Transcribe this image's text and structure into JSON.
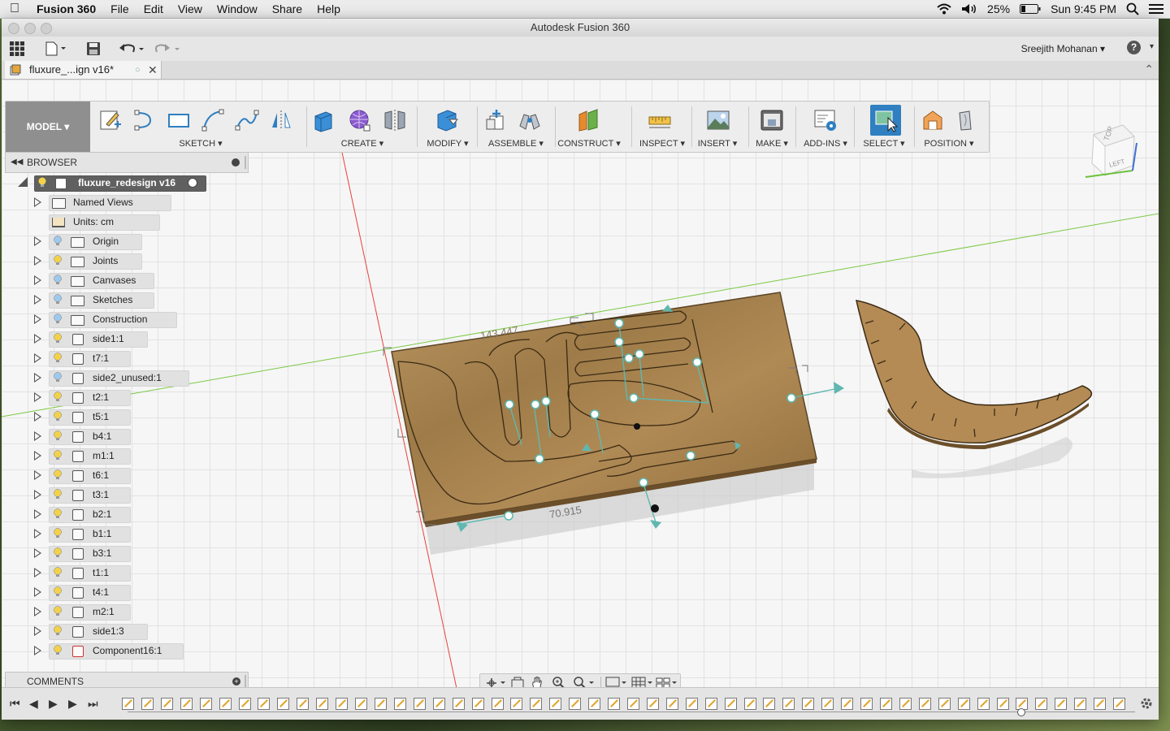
{
  "menubar": {
    "app": "Fusion 360",
    "items": [
      "File",
      "Edit",
      "View",
      "Window",
      "Share",
      "Help"
    ],
    "battery": "25%",
    "clock": "Sun 9:45 PM"
  },
  "window": {
    "title": "Autodesk Fusion 360",
    "user": "Sreejith Mohanan",
    "help": "?",
    "doc_tab": "fluxure_...ign v16*"
  },
  "toolbar": {
    "workspace": "MODEL",
    "groups": [
      "SKETCH",
      "CREATE",
      "MODIFY",
      "ASSEMBLE",
      "CONSTRUCT",
      "INSPECT",
      "INSERT",
      "MAKE",
      "ADD-INS",
      "SELECT",
      "POSITION"
    ]
  },
  "browser": {
    "title": "BROWSER",
    "root": "fluxure_redesign v16",
    "items": [
      {
        "label": "Named Views",
        "type": "folder",
        "bulb": "none"
      },
      {
        "label": "Units: cm",
        "type": "units",
        "bulb": "none"
      },
      {
        "label": "Origin",
        "type": "folder",
        "bulb": "blue"
      },
      {
        "label": "Joints",
        "type": "folder",
        "bulb": "yellow"
      },
      {
        "label": "Canvases",
        "type": "folder",
        "bulb": "blue"
      },
      {
        "label": "Sketches",
        "type": "folder",
        "bulb": "blue"
      },
      {
        "label": "Construction",
        "type": "folder",
        "bulb": "blue"
      },
      {
        "label": "side1:1",
        "type": "component",
        "bulb": "yellow"
      },
      {
        "label": "t7:1",
        "type": "component",
        "bulb": "yellow"
      },
      {
        "label": "side2_unused:1",
        "type": "component",
        "bulb": "blue"
      },
      {
        "label": "t2:1",
        "type": "component",
        "bulb": "yellow"
      },
      {
        "label": "t5:1",
        "type": "component",
        "bulb": "yellow"
      },
      {
        "label": "b4:1",
        "type": "component",
        "bulb": "yellow"
      },
      {
        "label": "m1:1",
        "type": "component",
        "bulb": "yellow"
      },
      {
        "label": "t6:1",
        "type": "component",
        "bulb": "yellow"
      },
      {
        "label": "t3:1",
        "type": "component",
        "bulb": "yellow"
      },
      {
        "label": "b2:1",
        "type": "component",
        "bulb": "yellow"
      },
      {
        "label": "b1:1",
        "type": "component",
        "bulb": "yellow"
      },
      {
        "label": "b3:1",
        "type": "component",
        "bulb": "yellow"
      },
      {
        "label": "t1:1",
        "type": "component",
        "bulb": "yellow"
      },
      {
        "label": "t4:1",
        "type": "component",
        "bulb": "yellow"
      },
      {
        "label": "m2:1",
        "type": "component",
        "bulb": "yellow"
      },
      {
        "label": "side1:3",
        "type": "component",
        "bulb": "yellow"
      },
      {
        "label": "Component16:1",
        "type": "component-link",
        "bulb": "yellow"
      }
    ]
  },
  "comments": {
    "title": "COMMENTS"
  },
  "viewport": {
    "dimension_top": "143.447",
    "dimension_bottom": "70.915",
    "viewcube_top": "TOP",
    "viewcube_left": "LEFT"
  },
  "colors": {
    "wood": "#a9844f",
    "axis_red": "#e8413c",
    "axis_green": "#7ac943",
    "select_blue": "#2f7fc1"
  }
}
